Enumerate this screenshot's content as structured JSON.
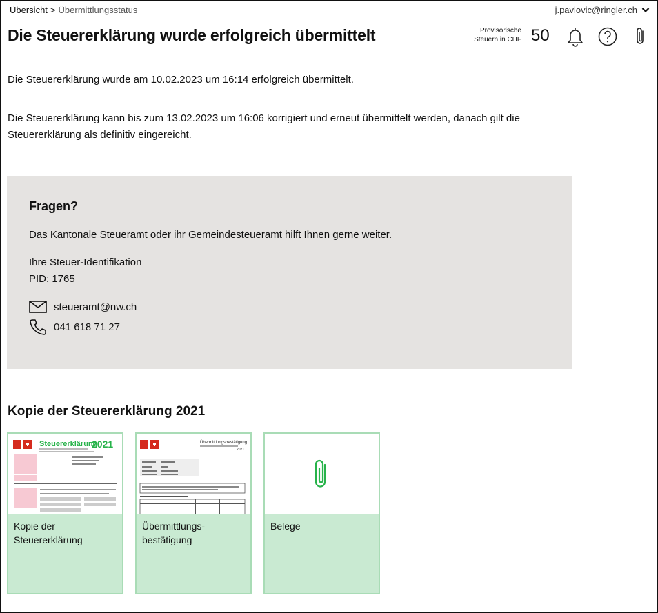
{
  "breadcrumb": {
    "home": "Übersicht",
    "separator": ">",
    "current": "Übermittlungsstatus"
  },
  "user": {
    "email": "j.pavlovic@ringler.ch",
    "icon": "chevron-down-icon"
  },
  "header": {
    "title": "Die Steuererklärung wurde erfolgreich übermittelt",
    "tax_label_line1": "Provisorische",
    "tax_label_line2": "Steuern in CHF",
    "tax_value": "50",
    "icons": [
      "bell-icon",
      "help-icon",
      "paperclip-icon"
    ]
  },
  "messages": {
    "submitted": "Die Steuererklärung wurde am 10.02.2023 um 16:14 erfolgreich übermittelt.",
    "correction_line1": "Die Steuererklärung kann bis zum 13.02.2023 um 16:06 korrigiert und erneut übermittelt werden, danach gilt die",
    "correction_line2": "Steuererklärung als definitiv eingereicht."
  },
  "help": {
    "title": "Fragen?",
    "text": "Das Kantonale Steueramt oder ihr Gemeindesteueramt hilft Ihnen gerne weiter.",
    "id_label": "Ihre Steuer-Identifikation",
    "pid": "PID: 1765",
    "email": "steueramt@nw.ch",
    "phone": "041 618 71 27"
  },
  "copies": {
    "title": "Kopie der Steuererklärung 2021",
    "cards": [
      {
        "label": "Kopie der\nSteuererklärung",
        "thumb_title": "Steuererklärung",
        "thumb_year": "2021"
      },
      {
        "label": "Übermittlungs-\nbestätigung",
        "thumb_title": "Übermittlungsbestätigung",
        "thumb_year": "2021"
      },
      {
        "label": "Belege"
      }
    ]
  },
  "colors": {
    "accent_green": "#27b34a",
    "card_bg": "#c9ead2",
    "card_border": "#a9dcb6",
    "info_bg": "#e5e3e1",
    "brand_red": "#d52b1e"
  }
}
